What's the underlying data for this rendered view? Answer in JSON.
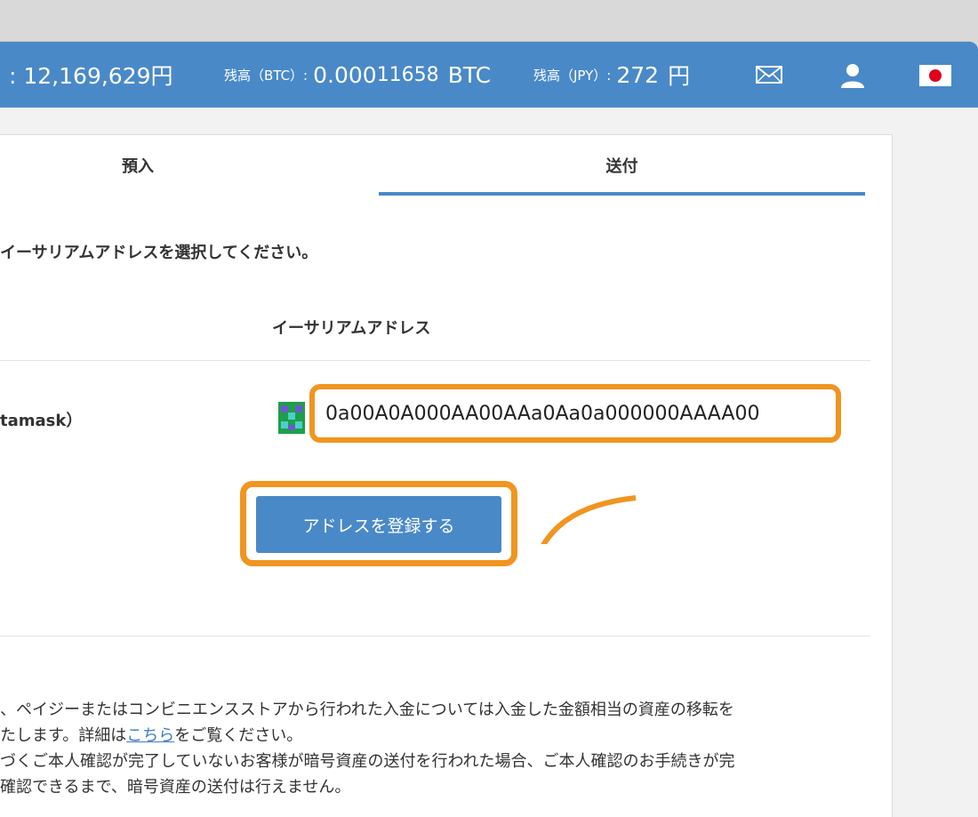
{
  "header": {
    "price_value": ": 12,169,629円",
    "btc_label": "残高（BTC）:",
    "btc_value_prefix": "0.000",
    "btc_value_suffix": "11658",
    "btc_unit": "BTC",
    "jpy_label": "残高（JPY）:",
    "jpy_value": "272",
    "jpy_unit": "円",
    "icons": [
      "mail-icon",
      "user-icon",
      "japan-flag-icon"
    ]
  },
  "tabs": [
    {
      "label": "預入",
      "active": false
    },
    {
      "label": "送付",
      "active": true
    }
  ],
  "form": {
    "heading": "イーサリアムアドレスを選択してください。",
    "column_header": "イーサリアムアドレス",
    "wallet_name": "tamask）",
    "address": "0a00A0A000AA00AAa0Aa0a000000AAAA00",
    "register_button": "アドレスを登録する"
  },
  "notes": {
    "line1": "、ペイジーまたはコンビニエンスストアから行われた入金については入金した金額相当の資産の移転を",
    "line2_before": "たします。詳細は",
    "line2_link": "こちら",
    "line2_after": "をご覧ください。",
    "line3": "づくご本人確認が完了していないお客様が暗号資産の送付を行われた場合、ご本人確認のお手続きが完",
    "line4": "確認できるまで、暗号資産の送付は行えません。"
  },
  "colors": {
    "header_blue": "#4a89c8",
    "highlight_orange": "#f0951f",
    "link_blue": "#3d7ec9"
  }
}
